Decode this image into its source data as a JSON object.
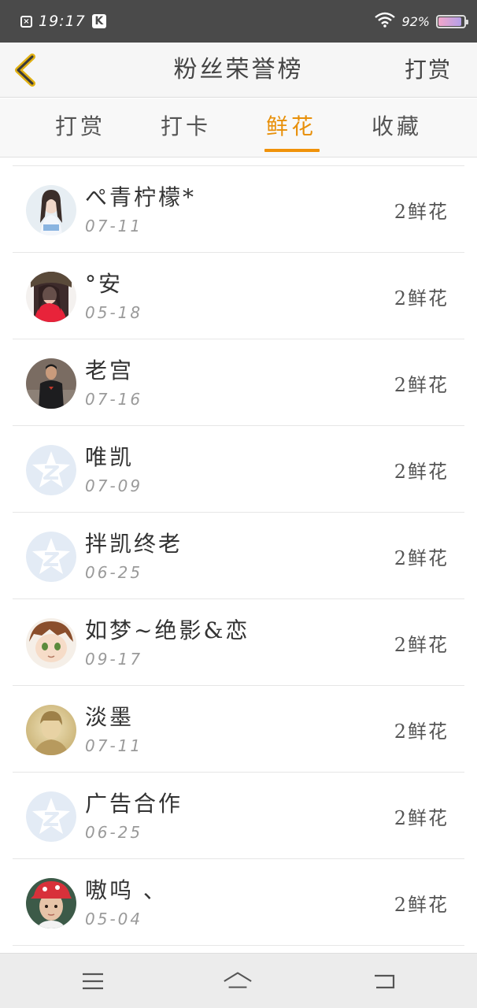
{
  "status_bar": {
    "time": "19:17",
    "battery_text": "92%",
    "battery_level": 0.92
  },
  "header": {
    "title": "粉丝荣誉榜",
    "action_label": "打赏"
  },
  "tabs": [
    {
      "label": "打赏",
      "active": false
    },
    {
      "label": "打卡",
      "active": false
    },
    {
      "label": "鲜花",
      "active": true
    },
    {
      "label": "收藏",
      "active": false
    }
  ],
  "fans": [
    {
      "name": "ぺ青柠檬*",
      "date": "07-11",
      "gift": "2鲜花",
      "avatar": "girl-photo-icon"
    },
    {
      "name": "°安",
      "date": "05-18",
      "gift": "2鲜花",
      "avatar": "girl-red-photo-icon"
    },
    {
      "name": "老宫",
      "date": "07-16",
      "gift": "2鲜花",
      "avatar": "man-photo-icon"
    },
    {
      "name": "唯凯",
      "date": "07-09",
      "gift": "2鲜花",
      "avatar": "default-qzone-icon"
    },
    {
      "name": "拌凯终老",
      "date": "06-25",
      "gift": "2鲜花",
      "avatar": "default-qzone-icon"
    },
    {
      "name": "如梦~绝影&恋",
      "date": "09-17",
      "gift": "2鲜花",
      "avatar": "anime-photo-icon"
    },
    {
      "name": "淡墨",
      "date": "07-11",
      "gift": "2鲜花",
      "avatar": "sepia-photo-icon"
    },
    {
      "name": "广告合作",
      "date": "06-25",
      "gift": "2鲜花",
      "avatar": "default-qzone-icon"
    },
    {
      "name": "嗷呜 、",
      "date": "05-04",
      "gift": "2鲜花",
      "avatar": "boy-photo-icon"
    }
  ],
  "colors": {
    "accent": "#f0920a",
    "status_bar_bg": "#4a4a4a",
    "header_bg": "#f6f6f6",
    "nav_bg": "#ececec"
  }
}
